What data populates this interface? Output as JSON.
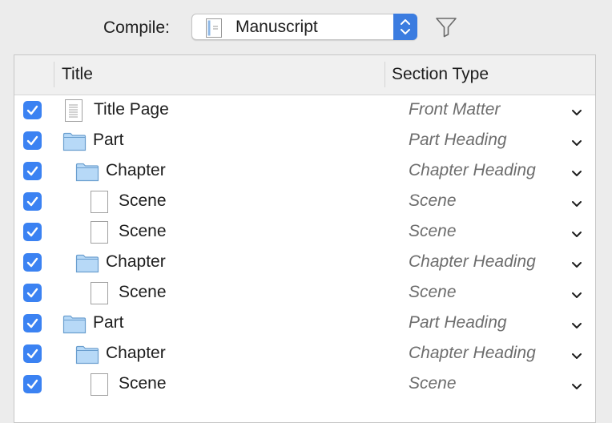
{
  "compile": {
    "label": "Compile:",
    "selected_format": "Manuscript",
    "popup_icon": "document-icon",
    "stepper_icon": "up-down-chevron-icon",
    "filter_icon": "filter-funnel-icon"
  },
  "table": {
    "columns": {
      "title": "Title",
      "section_type": "Section Type"
    },
    "rows": [
      {
        "title": "Title Page",
        "section_type": "Front Matter",
        "kind": "page",
        "level": 0,
        "checked": true
      },
      {
        "title": "Part",
        "section_type": "Part Heading",
        "kind": "folder",
        "level": 0,
        "checked": true
      },
      {
        "title": "Chapter",
        "section_type": "Chapter Heading",
        "kind": "folder",
        "level": 1,
        "checked": true
      },
      {
        "title": "Scene",
        "section_type": "Scene",
        "kind": "blank",
        "level": 2,
        "checked": true
      },
      {
        "title": "Scene",
        "section_type": "Scene",
        "kind": "blank",
        "level": 2,
        "checked": true
      },
      {
        "title": "Chapter",
        "section_type": "Chapter Heading",
        "kind": "folder",
        "level": 1,
        "checked": true
      },
      {
        "title": "Scene",
        "section_type": "Scene",
        "kind": "blank",
        "level": 2,
        "checked": true
      },
      {
        "title": "Part",
        "section_type": "Part Heading",
        "kind": "folder",
        "level": 0,
        "checked": true
      },
      {
        "title": "Chapter",
        "section_type": "Chapter Heading",
        "kind": "folder",
        "level": 1,
        "checked": true
      },
      {
        "title": "Scene",
        "section_type": "Scene",
        "kind": "blank",
        "level": 2,
        "checked": true
      }
    ]
  },
  "colors": {
    "accent": "#3b82f2",
    "stepper": "#3b7ce0",
    "folder_fill": "#b7d9f7",
    "folder_stroke": "#6b9fcf",
    "section_type_text": "#6d6d6d"
  }
}
